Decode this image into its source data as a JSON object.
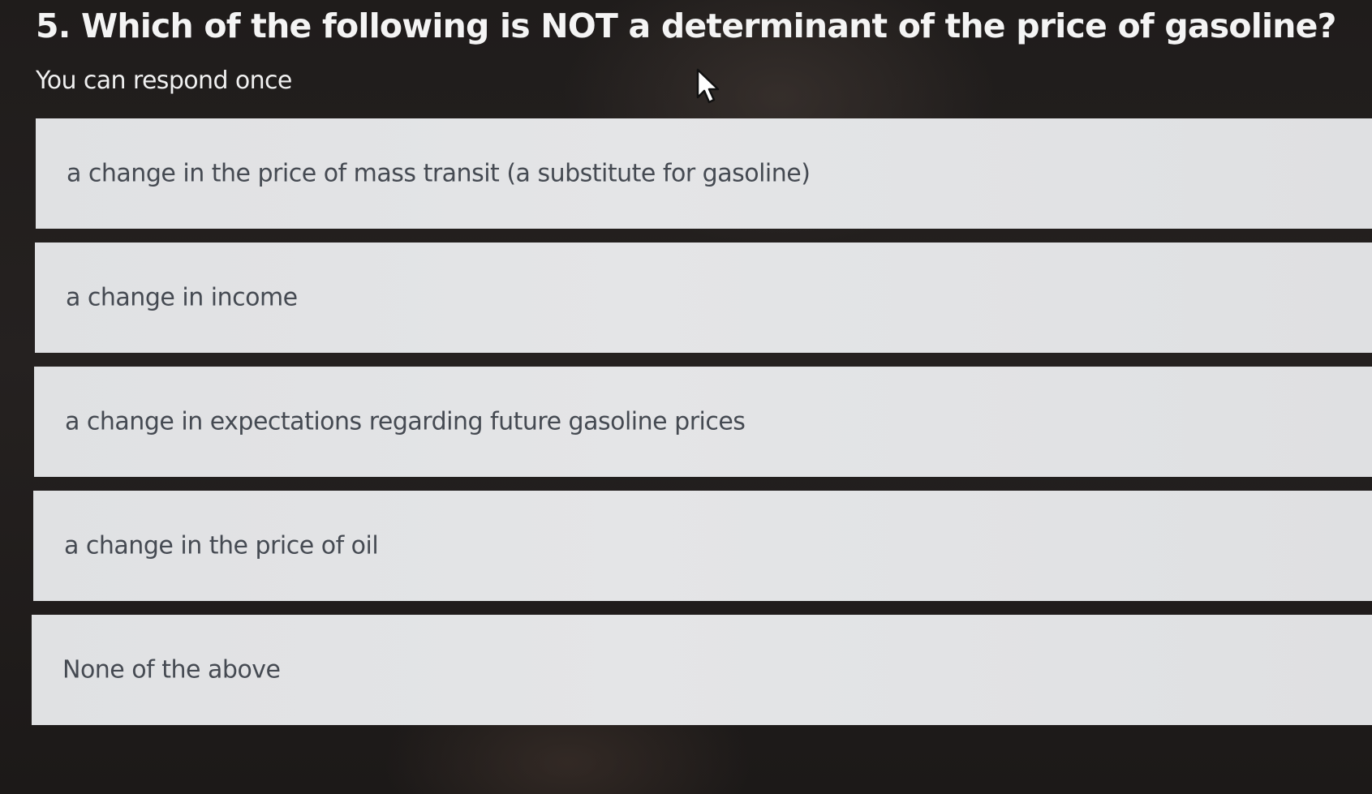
{
  "question": {
    "title": "5. Which of the following is NOT a determinant of the price of gasoline?",
    "note": "You can respond once"
  },
  "options": [
    {
      "label": "a change in the price of mass transit (a substitute for gasoline)"
    },
    {
      "label": "a change in income"
    },
    {
      "label": "a change in expectations regarding future gasoline prices"
    },
    {
      "label": "a change in the price of oil"
    },
    {
      "label": "None of the above"
    }
  ],
  "cursor": {
    "icon": "mouse-pointer-icon"
  },
  "colors": {
    "background": "#221f1e",
    "option_background": "#e2e3e5",
    "option_text": "#454a52",
    "title_text": "#f4f4f4"
  }
}
